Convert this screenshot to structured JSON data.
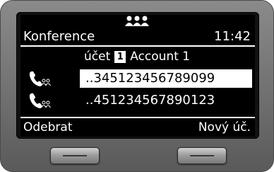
{
  "header": {
    "status_icon": "conference-people-icon",
    "title": "Konference",
    "time": "11:42"
  },
  "account": {
    "prefix": "účet",
    "badge": "1",
    "name": "Account 1"
  },
  "calls": [
    {
      "icon": "handset-conference-icon",
      "number": "..345123456789099",
      "selected": true
    },
    {
      "icon": "handset-conference-icon",
      "number": "..451234567890123",
      "selected": false
    }
  ],
  "softkeys": {
    "left": "Odebrat",
    "right": "Nový úč."
  },
  "colors": {
    "screen_bg": "#000000",
    "screen_fg": "#ffffff",
    "device_body": "#6e6e6e"
  }
}
